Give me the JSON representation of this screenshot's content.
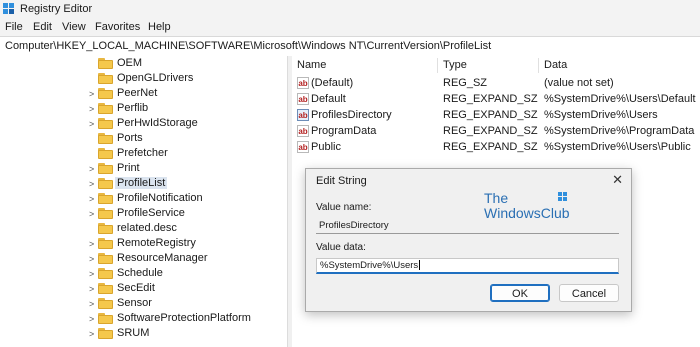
{
  "window": {
    "title": "Registry Editor"
  },
  "menu": [
    "File",
    "Edit",
    "View",
    "Favorites",
    "Help"
  ],
  "address": "Computer\\HKEY_LOCAL_MACHINE\\SOFTWARE\\Microsoft\\Windows NT\\CurrentVersion\\ProfileList",
  "tree": {
    "items": [
      "OEM",
      "OpenGLDrivers",
      "PeerNet",
      "Perflib",
      "PerHwIdStorage",
      "Ports",
      "Prefetcher",
      "Print",
      "ProfileList",
      "ProfileNotification",
      "ProfileService",
      "related.desc",
      "RemoteRegistry",
      "ResourceManager",
      "Schedule",
      "SecEdit",
      "Sensor",
      "SoftwareProtectionPlatform",
      "SRUM"
    ],
    "selected": "ProfileList"
  },
  "values": {
    "headers": {
      "name": "Name",
      "type": "Type",
      "data": "Data"
    },
    "rows": [
      {
        "name": "(Default)",
        "type": "REG_SZ",
        "data": "(value not set)"
      },
      {
        "name": "Default",
        "type": "REG_EXPAND_SZ",
        "data": "%SystemDrive%\\Users\\Default"
      },
      {
        "name": "ProfilesDirectory",
        "type": "REG_EXPAND_SZ",
        "data": "%SystemDrive%\\Users"
      },
      {
        "name": "ProgramData",
        "type": "REG_EXPAND_SZ",
        "data": "%SystemDrive%\\ProgramData"
      },
      {
        "name": "Public",
        "type": "REG_EXPAND_SZ",
        "data": "%SystemDrive%\\Users\\Public"
      }
    ]
  },
  "dialog": {
    "title": "Edit String",
    "close_label": "✕",
    "value_name_label": "Value name:",
    "value_name": "ProfilesDirectory",
    "value_data_label": "Value data:",
    "value_data": "%SystemDrive%\\Users",
    "ok_label": "OK",
    "cancel_label": "Cancel"
  },
  "watermark": {
    "line1": "The",
    "line2": "WindowsClub"
  },
  "icons": {
    "reg_value": "ab",
    "folder": "folder-icon"
  },
  "colors": {
    "accent": "#1f6fc0",
    "folder": "#f5c84c",
    "selection": "#dbe4ef"
  }
}
